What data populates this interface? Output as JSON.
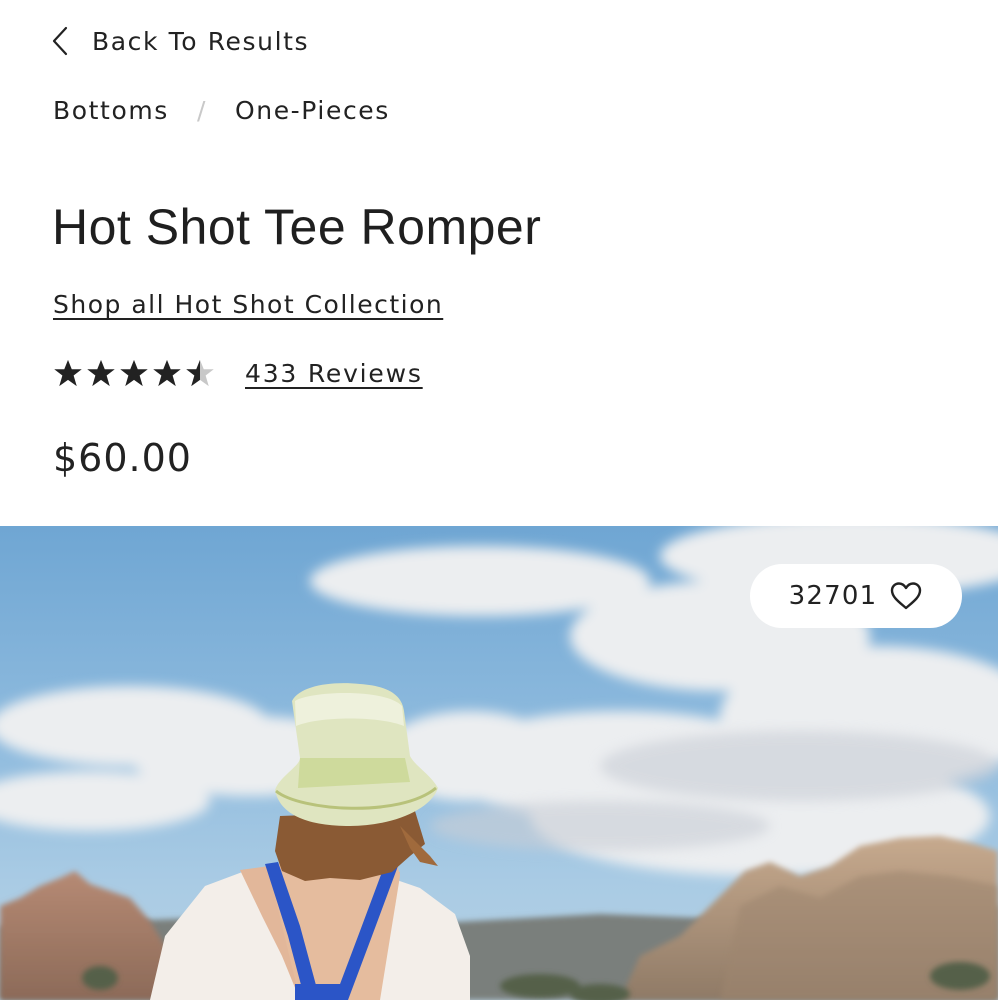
{
  "nav": {
    "back_label": "Back To Results"
  },
  "breadcrumb": {
    "items": [
      "Bottoms",
      "One-Pieces"
    ],
    "separator": "/"
  },
  "product": {
    "title": "Hot Shot Tee Romper",
    "collection_link": "Shop all Hot Shot Collection",
    "rating": 4.5,
    "rating_max": 5,
    "reviews_label": "433 Reviews",
    "price": "$60.00"
  },
  "hero": {
    "likes_count": "32701",
    "like_icon": "heart-outline-icon"
  },
  "colors": {
    "text": "#222222",
    "star_filled": "#222222",
    "star_empty": "#c8c8c8"
  }
}
